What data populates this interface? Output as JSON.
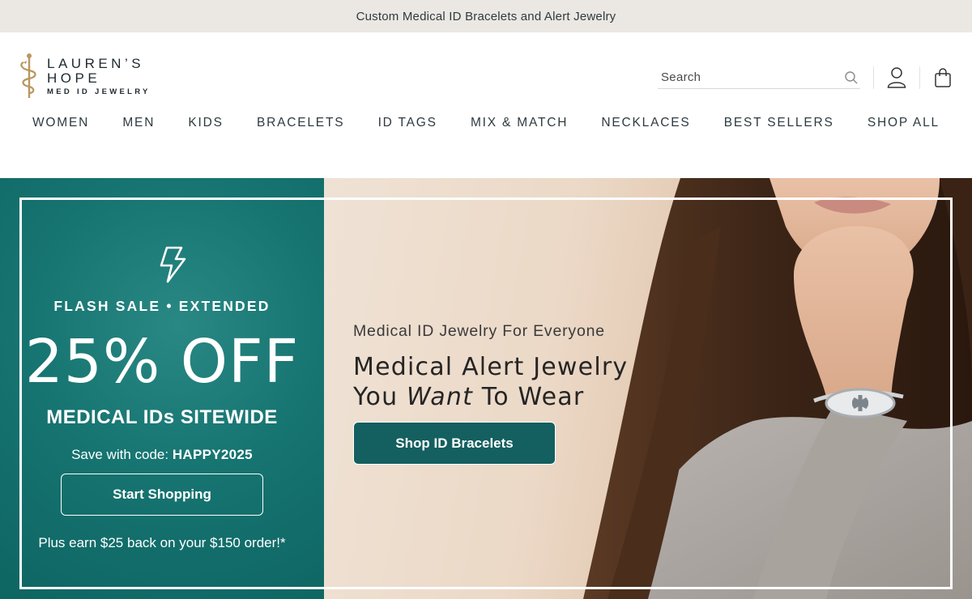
{
  "announcement": "Custom Medical ID Bracelets and Alert Jewelry",
  "brand": {
    "line1": "LAUREN’S",
    "line2": "HOPE",
    "line3": "MED ID JEWELRY"
  },
  "search": {
    "placeholder": "Search",
    "icon": "search-icon"
  },
  "header_icons": [
    "account-icon",
    "shopping-bag-icon"
  ],
  "nav": [
    "WOMEN",
    "MEN",
    "KIDS",
    "BRACELETS",
    "ID TAGS",
    "MIX & MATCH",
    "NECKLACES",
    "BEST SELLERS",
    "SHOP ALL"
  ],
  "promo": {
    "icon": "lightning-bolt-icon",
    "flash": "FLASH SALE • EXTENDED",
    "percent": "25% OFF",
    "sitewide": "MEDICAL IDs SITEWIDE",
    "code_prefix": "Save with code:",
    "code": "HAPPY2025",
    "button": "Start Shopping",
    "earn": "Plus earn $25 back on your $150 order!*"
  },
  "hero": {
    "eyebrow": "Medical ID Jewelry For Everyone",
    "headline_1": "Medical Alert Jewelry",
    "headline_2a": "You ",
    "headline_2b": "Want",
    "headline_2c": " To Wear",
    "button": "Shop ID Bracelets"
  },
  "colors": {
    "teal": "#167471",
    "button_teal": "#145f5f",
    "announce_bg": "#ebe7e2",
    "logo_gold": "#b8975f"
  }
}
